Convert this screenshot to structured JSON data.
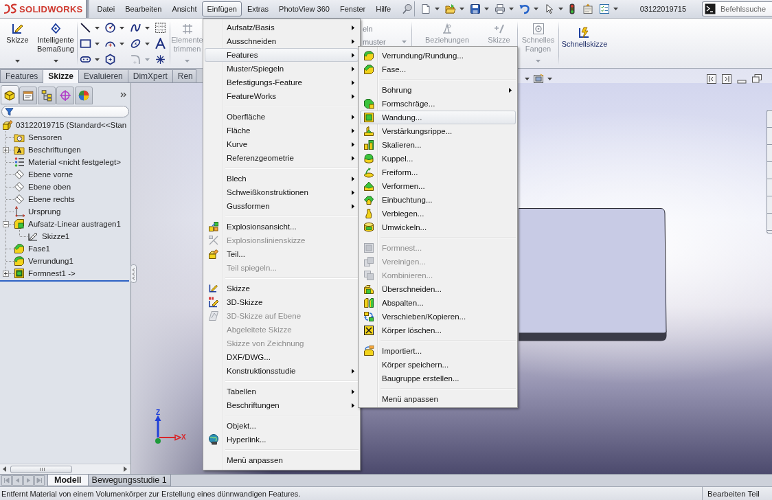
{
  "title_bar": {
    "logo": "SOLIDWORKS",
    "document_title": "03122019715",
    "search": {
      "placeholder": "Befehlssuche"
    }
  },
  "menu_bar": [
    {
      "label": "Datei",
      "selected": false
    },
    {
      "label": "Bearbeiten",
      "selected": false
    },
    {
      "label": "Ansicht",
      "selected": false
    },
    {
      "label": "Einfügen",
      "selected": true
    },
    {
      "label": "Extras",
      "selected": false
    },
    {
      "label": "PhotoView 360",
      "selected": false
    },
    {
      "label": "Fenster",
      "selected": false
    },
    {
      "label": "Hilfe",
      "selected": false
    }
  ],
  "ribbon": {
    "groups": [
      {
        "items": [
          {
            "kind": "large",
            "label": "Skizze",
            "disabled": false,
            "dropdown": true
          },
          {
            "kind": "large",
            "label": "Intelligente Bemaßung",
            "disabled": false,
            "dropdown": true
          }
        ]
      },
      {
        "items": [
          {
            "kind": "tool_grid"
          }
        ]
      },
      {
        "items": [
          {
            "kind": "large",
            "label": "Elemente trimmen",
            "disabled": true,
            "dropdown": true
          }
        ]
      },
      {
        "items": [
          {
            "kind": "small",
            "label": "eln",
            "disabled": true,
            "dropdown": false
          },
          {
            "kind": "small",
            "label": "muster",
            "disabled": true,
            "dropdown": true
          }
        ]
      },
      {
        "items": [
          {
            "kind": "large",
            "label": "Beziehungen",
            "disabled": true,
            "dropdown": false
          },
          {
            "kind": "large",
            "label": "Skizze",
            "disabled": true,
            "dropdown": false
          }
        ]
      },
      {
        "items": [
          {
            "kind": "large",
            "label": "Schnelles Fangen",
            "disabled": true,
            "dropdown": true
          }
        ]
      },
      {
        "items": [
          {
            "kind": "large",
            "label": "Schnellskizze",
            "disabled": false,
            "dropdown": false
          }
        ]
      }
    ]
  },
  "command_tabs": [
    {
      "label": "Features",
      "selected": false
    },
    {
      "label": "Skizze",
      "selected": true
    },
    {
      "label": "Evaluieren",
      "selected": false
    },
    {
      "label": "DimXpert",
      "selected": false
    },
    {
      "label": "Ren",
      "selected": false
    }
  ],
  "feature_tree": {
    "tabs": [
      {
        "selected": true
      },
      {
        "selected": false
      },
      {
        "selected": false
      },
      {
        "selected": false
      },
      {
        "selected": false
      }
    ],
    "root": {
      "label": "03122019715 (Standard<<Stan",
      "children": [
        {
          "label": "Sensoren"
        },
        {
          "label": "Beschriftungen",
          "expanded": false
        },
        {
          "label": "Material <nicht festgelegt>"
        },
        {
          "label": "Ebene vorne"
        },
        {
          "label": "Ebene oben"
        },
        {
          "label": "Ebene rechts"
        },
        {
          "label": "Ursprung"
        },
        {
          "label": "Aufsatz-Linear austragen1",
          "expanded": true,
          "children": [
            {
              "label": "Skizze1"
            }
          ]
        },
        {
          "label": "Fase1"
        },
        {
          "label": "Verrundung1"
        },
        {
          "label": "Formnest1 ->",
          "expanded": false
        }
      ]
    }
  },
  "viewport": {
    "triad_labels": [
      "Z",
      "X"
    ]
  },
  "model_tabs": [
    {
      "label": "Modell",
      "selected": true
    },
    {
      "label": "Bewegungsstudie 1",
      "selected": false
    }
  ],
  "status_bar": {
    "message": "Entfernt Material von einem Volumenkörper zur Erstellung eines dünnwandigen Features.",
    "mode": "Bearbeiten Teil"
  },
  "insert_menu": {
    "groups": [
      [
        {
          "label": "Aufsatz/Basis",
          "submenu": true,
          "disabled": false,
          "selected": false
        },
        {
          "label": "Ausschneiden",
          "submenu": true,
          "disabled": false,
          "selected": false
        },
        {
          "label": "Features",
          "submenu": true,
          "disabled": false,
          "selected": true
        },
        {
          "label": "Muster/Spiegeln",
          "submenu": true,
          "disabled": false,
          "selected": false
        },
        {
          "label": "Befestigungs-Feature",
          "submenu": true,
          "disabled": false,
          "selected": false
        },
        {
          "label": "FeatureWorks",
          "submenu": true,
          "disabled": false,
          "selected": false
        }
      ],
      [
        {
          "label": "Oberfläche",
          "submenu": true,
          "disabled": false,
          "selected": false
        },
        {
          "label": "Fläche",
          "submenu": true,
          "disabled": false,
          "selected": false
        },
        {
          "label": "Kurve",
          "submenu": true,
          "disabled": false,
          "selected": false
        },
        {
          "label": "Referenzgeometrie",
          "submenu": true,
          "disabled": false,
          "selected": false
        }
      ],
      [
        {
          "label": "Blech",
          "submenu": true,
          "disabled": false,
          "selected": false
        },
        {
          "label": "Schweißkonstruktionen",
          "submenu": true,
          "disabled": false,
          "selected": false
        },
        {
          "label": "Gussformen",
          "submenu": true,
          "disabled": false,
          "selected": false
        }
      ],
      [
        {
          "label": "Explosionsansicht...",
          "submenu": false,
          "disabled": false,
          "selected": false
        },
        {
          "label": "Explosionslinienskizze",
          "submenu": false,
          "disabled": true,
          "selected": false
        },
        {
          "label": "Teil...",
          "submenu": false,
          "disabled": false,
          "selected": false
        },
        {
          "label": "Teil spiegeln...",
          "submenu": false,
          "disabled": true,
          "selected": false
        }
      ],
      [
        {
          "label": "Skizze",
          "submenu": false,
          "disabled": false,
          "selected": false
        },
        {
          "label": "3D-Skizze",
          "submenu": false,
          "disabled": false,
          "selected": false
        },
        {
          "label": "3D-Skizze auf Ebene",
          "submenu": false,
          "disabled": true,
          "selected": false
        },
        {
          "label": "Abgeleitete Skizze",
          "submenu": false,
          "disabled": true,
          "selected": false
        },
        {
          "label": "Skizze von Zeichnung",
          "submenu": false,
          "disabled": true,
          "selected": false
        },
        {
          "label": "DXF/DWG...",
          "submenu": false,
          "disabled": false,
          "selected": false
        },
        {
          "label": "Konstruktionsstudie",
          "submenu": true,
          "disabled": false,
          "selected": false
        }
      ],
      [
        {
          "label": "Tabellen",
          "submenu": true,
          "disabled": false,
          "selected": false
        },
        {
          "label": "Beschriftungen",
          "submenu": true,
          "disabled": false,
          "selected": false
        }
      ],
      [
        {
          "label": "Objekt...",
          "submenu": false,
          "disabled": false,
          "selected": false
        },
        {
          "label": "Hyperlink...",
          "submenu": false,
          "disabled": false,
          "selected": false
        }
      ],
      [
        {
          "label": "Menü anpassen",
          "submenu": false,
          "disabled": false,
          "selected": false
        }
      ]
    ]
  },
  "features_submenu": {
    "groups": [
      [
        {
          "label": "Verrundung/Rundung...",
          "submenu": false,
          "disabled": false,
          "selected": false
        },
        {
          "label": "Fase...",
          "submenu": false,
          "disabled": false,
          "selected": false
        }
      ],
      [
        {
          "label": "Bohrung",
          "submenu": true,
          "disabled": false,
          "selected": false
        },
        {
          "label": "Formschräge...",
          "submenu": false,
          "disabled": false,
          "selected": false
        },
        {
          "label": "Wandung...",
          "submenu": false,
          "disabled": false,
          "selected": true
        },
        {
          "label": "Verstärkungsrippe...",
          "submenu": false,
          "disabled": false,
          "selected": false
        },
        {
          "label": "Skalieren...",
          "submenu": false,
          "disabled": false,
          "selected": false
        },
        {
          "label": "Kuppel...",
          "submenu": false,
          "disabled": false,
          "selected": false
        },
        {
          "label": "Freiform...",
          "submenu": false,
          "disabled": false,
          "selected": false
        },
        {
          "label": "Verformen...",
          "submenu": false,
          "disabled": false,
          "selected": false
        },
        {
          "label": "Einbuchtung...",
          "submenu": false,
          "disabled": false,
          "selected": false
        },
        {
          "label": "Verbiegen...",
          "submenu": false,
          "disabled": false,
          "selected": false
        },
        {
          "label": "Umwickeln...",
          "submenu": false,
          "disabled": false,
          "selected": false
        }
      ],
      [
        {
          "label": "Formnest...",
          "submenu": false,
          "disabled": true,
          "selected": false
        },
        {
          "label": "Vereinigen...",
          "submenu": false,
          "disabled": true,
          "selected": false
        },
        {
          "label": "Kombinieren...",
          "submenu": false,
          "disabled": true,
          "selected": false
        },
        {
          "label": "Überschneiden...",
          "submenu": false,
          "disabled": false,
          "selected": false
        },
        {
          "label": "Abspalten...",
          "submenu": false,
          "disabled": false,
          "selected": false
        },
        {
          "label": "Verschieben/Kopieren...",
          "submenu": false,
          "disabled": false,
          "selected": false
        },
        {
          "label": "Körper löschen...",
          "submenu": false,
          "disabled": false,
          "selected": false
        }
      ],
      [
        {
          "label": "Importiert...",
          "submenu": false,
          "disabled": false,
          "selected": false
        },
        {
          "label": "Körper speichern...",
          "submenu": false,
          "disabled": false,
          "selected": false
        },
        {
          "label": "Baugruppe erstellen...",
          "submenu": false,
          "disabled": false,
          "selected": false
        }
      ],
      [
        {
          "label": "Menü anpassen",
          "submenu": false,
          "disabled": false,
          "selected": false
        }
      ]
    ]
  }
}
